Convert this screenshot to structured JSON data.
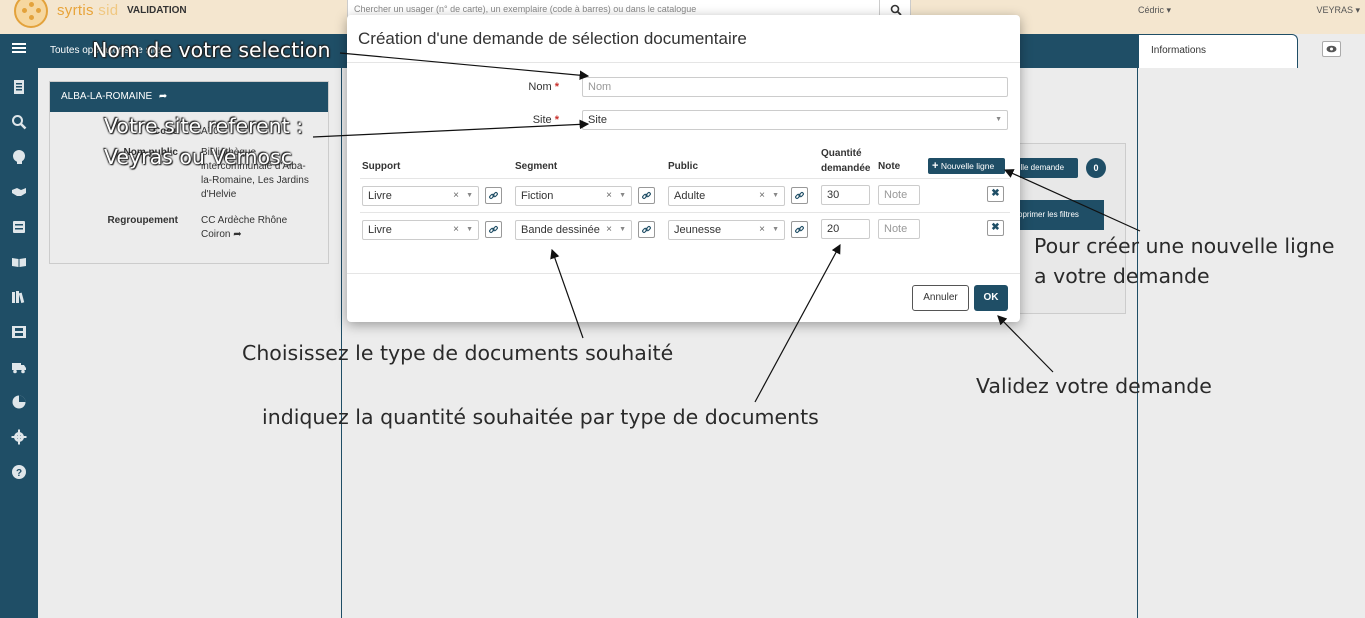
{
  "topbar": {
    "app_name_part1": "syrtis",
    "app_name_part2": "sid",
    "env_label": "VALIDATION",
    "search_placeholder": "Chercher un usager (n° de carte), un exemplaire (code à barres) ou dans le catalogue",
    "user": "Cédric ▾",
    "site": "VEYRAS ▾"
  },
  "subbar": {
    "text": "Toutes opérations de site"
  },
  "right_panel": {
    "tab_label": "Informations"
  },
  "library_card": {
    "title": "ALBA-LA-ROMAINE",
    "rows": [
      {
        "key": "Code",
        "value": "A70"
      },
      {
        "key": "Nom public",
        "value": "Bibliothèque intercommunale d'Alba-la-Romaine, Les Jardins d'Helvie"
      },
      {
        "key": "Regroupement",
        "value": "CC Ardèche Rhône Coiron"
      }
    ]
  },
  "background": {
    "new_request_btn": "elle demande",
    "badge": "0",
    "filters_btn": "pprimer les filtres"
  },
  "modal": {
    "title": "Création d'une demande de sélection documentaire",
    "name_label": "Nom",
    "name_placeholder": "Nom",
    "site_label": "Site",
    "site_value": "Site",
    "columns": {
      "support": "Support",
      "segment": "Segment",
      "public": "Public",
      "quantity_line1": "Quantité",
      "quantity_line2": "demandée",
      "note": "Note"
    },
    "add_line_label": "Nouvelle ligne",
    "rows": [
      {
        "support": "Livre",
        "segment": "Fiction",
        "public": "Adulte",
        "quantity": "30",
        "note_placeholder": "Note"
      },
      {
        "support": "Livre",
        "segment": "Bande dessinée",
        "public": "Jeunesse",
        "quantity": "20",
        "note_placeholder": "Note"
      }
    ],
    "cancel_label": "Annuler",
    "ok_label": "OK"
  },
  "annotations": {
    "name": "Nom de votre selection",
    "site_line1": "Votre site referent :",
    "site_line2": "Veyras ou Vernosc",
    "new_line_1": "Pour créer une nouvelle ligne",
    "new_line_2": "a votre demande",
    "type": "Choisissez le type de documents souhaité",
    "quantity": "indiquez la quantité souhaitée par type de documents",
    "validate": "Validez votre demande"
  }
}
